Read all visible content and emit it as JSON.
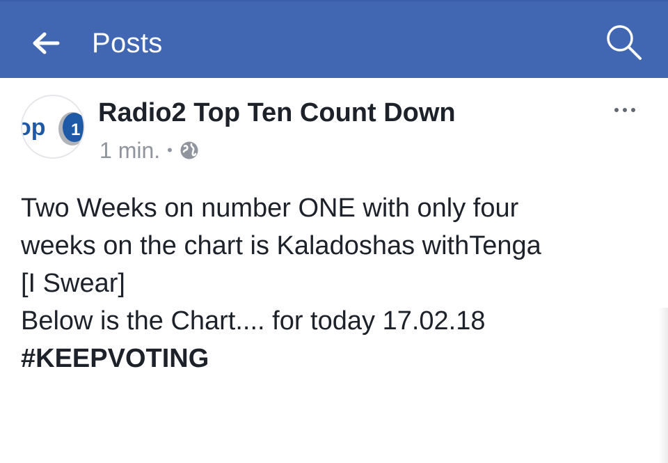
{
  "topbar": {
    "title": "Posts",
    "back_icon": "arrow-left-icon",
    "search_icon": "search-icon",
    "color": "#4267b2"
  },
  "post": {
    "page_name": "Radio2 Top Ten Count Down",
    "avatar_text": "op",
    "avatar_badge": "1",
    "timestamp": "1 min.",
    "separator": "•",
    "privacy_icon": "globe-icon",
    "more_icon": "more-dots-icon",
    "body_lines": [
      "Two Weeks on number ONE with only four",
      "weeks on the chart is Kaladoshas withTenga",
      "[I Swear]",
      "Below is the Chart.... for today 17.02.18"
    ],
    "hashtag": "#KEEPVOTING"
  }
}
